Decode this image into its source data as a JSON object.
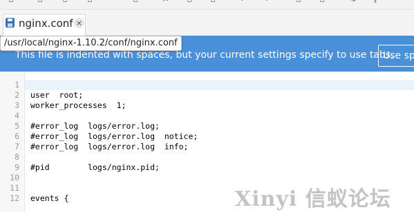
{
  "toolbar": {
    "icons": [
      "new-file-icon",
      "open-file-icon",
      "save-icon",
      "save-as-icon",
      "close-icon",
      "cut-icon",
      "copy-icon",
      "paste-icon",
      "undo-icon",
      "redo-icon",
      "find-icon",
      "replace-icon",
      "pilcrow-icon"
    ]
  },
  "tab": {
    "label": "nginx.conf",
    "close": "×"
  },
  "tooltip": {
    "path": "/usr/local/nginx-1.10.2/conf/nginx.conf"
  },
  "infobar": {
    "message": "This file is indented with spaces, but your current settings specify to use tabs.",
    "button_label": "Use spaces"
  },
  "editor": {
    "current_line": 1,
    "lines": [
      {
        "n": "1",
        "text": ""
      },
      {
        "n": "2",
        "text": "user  root;"
      },
      {
        "n": "3",
        "text": "worker_processes  1;"
      },
      {
        "n": "4",
        "text": ""
      },
      {
        "n": "5",
        "text": "#error_log  logs/error.log;"
      },
      {
        "n": "6",
        "text": "#error_log  logs/error.log  notice;"
      },
      {
        "n": "7",
        "text": "#error_log  logs/error.log  info;"
      },
      {
        "n": "8",
        "text": ""
      },
      {
        "n": "9",
        "text": "#pid        logs/nginx.pid;"
      },
      {
        "n": "10",
        "text": ""
      },
      {
        "n": "11",
        "text": ""
      },
      {
        "n": "12",
        "text": "events {"
      }
    ]
  },
  "watermark": {
    "text": "Xinyi 信蚁论坛"
  }
}
